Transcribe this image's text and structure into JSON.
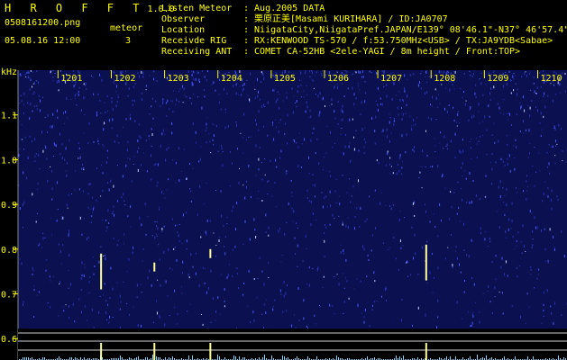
{
  "header": {
    "app_name": "H R O F F T",
    "version": "1.0.0",
    "filename": "0508161200.png",
    "datetime": "05.08.16 12:00",
    "meteor_label": "meteor",
    "meteor_count": "3"
  },
  "info": [
    {
      "label": "Listen Meteor",
      "value": ": Aug.2005 DATA"
    },
    {
      "label": "Observer",
      "value": ": 栗原正美[Masami KURIHARA] / ID:JA0707"
    },
    {
      "label": "Location",
      "value": ": NiigataCity,NiigataPref.JAPAN/E139° 08'46.1\"-N37° 46'57.4\""
    },
    {
      "label": "Receivde RIG",
      "value": ": RX:KENWOOD TS-570 / f:53.750MHz<USB> / TX:JA9YDB<Sabae>"
    },
    {
      "label": "Receiving ANT",
      "value": ": COMET CA-52HB <2ele-YAGI / 8m height / Front:TOP>"
    }
  ],
  "colors": {
    "text": "#ffff00",
    "spectrogram_base": "#0b1050",
    "speckle": "#4a5cff",
    "grid": "#888888",
    "meteor": "#ffff99",
    "level_line": "#d0d0d0",
    "noise": "#7fd6ff"
  },
  "chart_data": {
    "type": "heatmap",
    "ylabel": "kHz",
    "y_ticks": [
      "1.1",
      "1.0",
      "0.9",
      "0.8",
      "0.7",
      "0.6"
    ],
    "y_tick_values": [
      1.1,
      1.0,
      0.9,
      0.8,
      0.7,
      0.6
    ],
    "ylim": [
      0.58,
      1.2
    ],
    "x_ticks": [
      "1201",
      "1202",
      "1203",
      "1204",
      "1205",
      "1206",
      "1207",
      "1208",
      "1209",
      "1210"
    ],
    "x_tick_values": [
      1201,
      1202,
      1203,
      1204,
      1205,
      1206,
      1207,
      1208,
      1209,
      1210
    ],
    "xlim": [
      1200.25,
      1210.55
    ],
    "meteor_events": [
      {
        "time": 1201.8,
        "freq_top": 0.79,
        "freq_bottom": 0.71
      },
      {
        "time": 1202.8,
        "freq_top": 0.77,
        "freq_bottom": 0.75
      },
      {
        "time": 1203.85,
        "freq_top": 0.8,
        "freq_bottom": 0.78
      },
      {
        "time": 1207.9,
        "freq_top": 0.81,
        "freq_bottom": 0.73
      }
    ]
  }
}
